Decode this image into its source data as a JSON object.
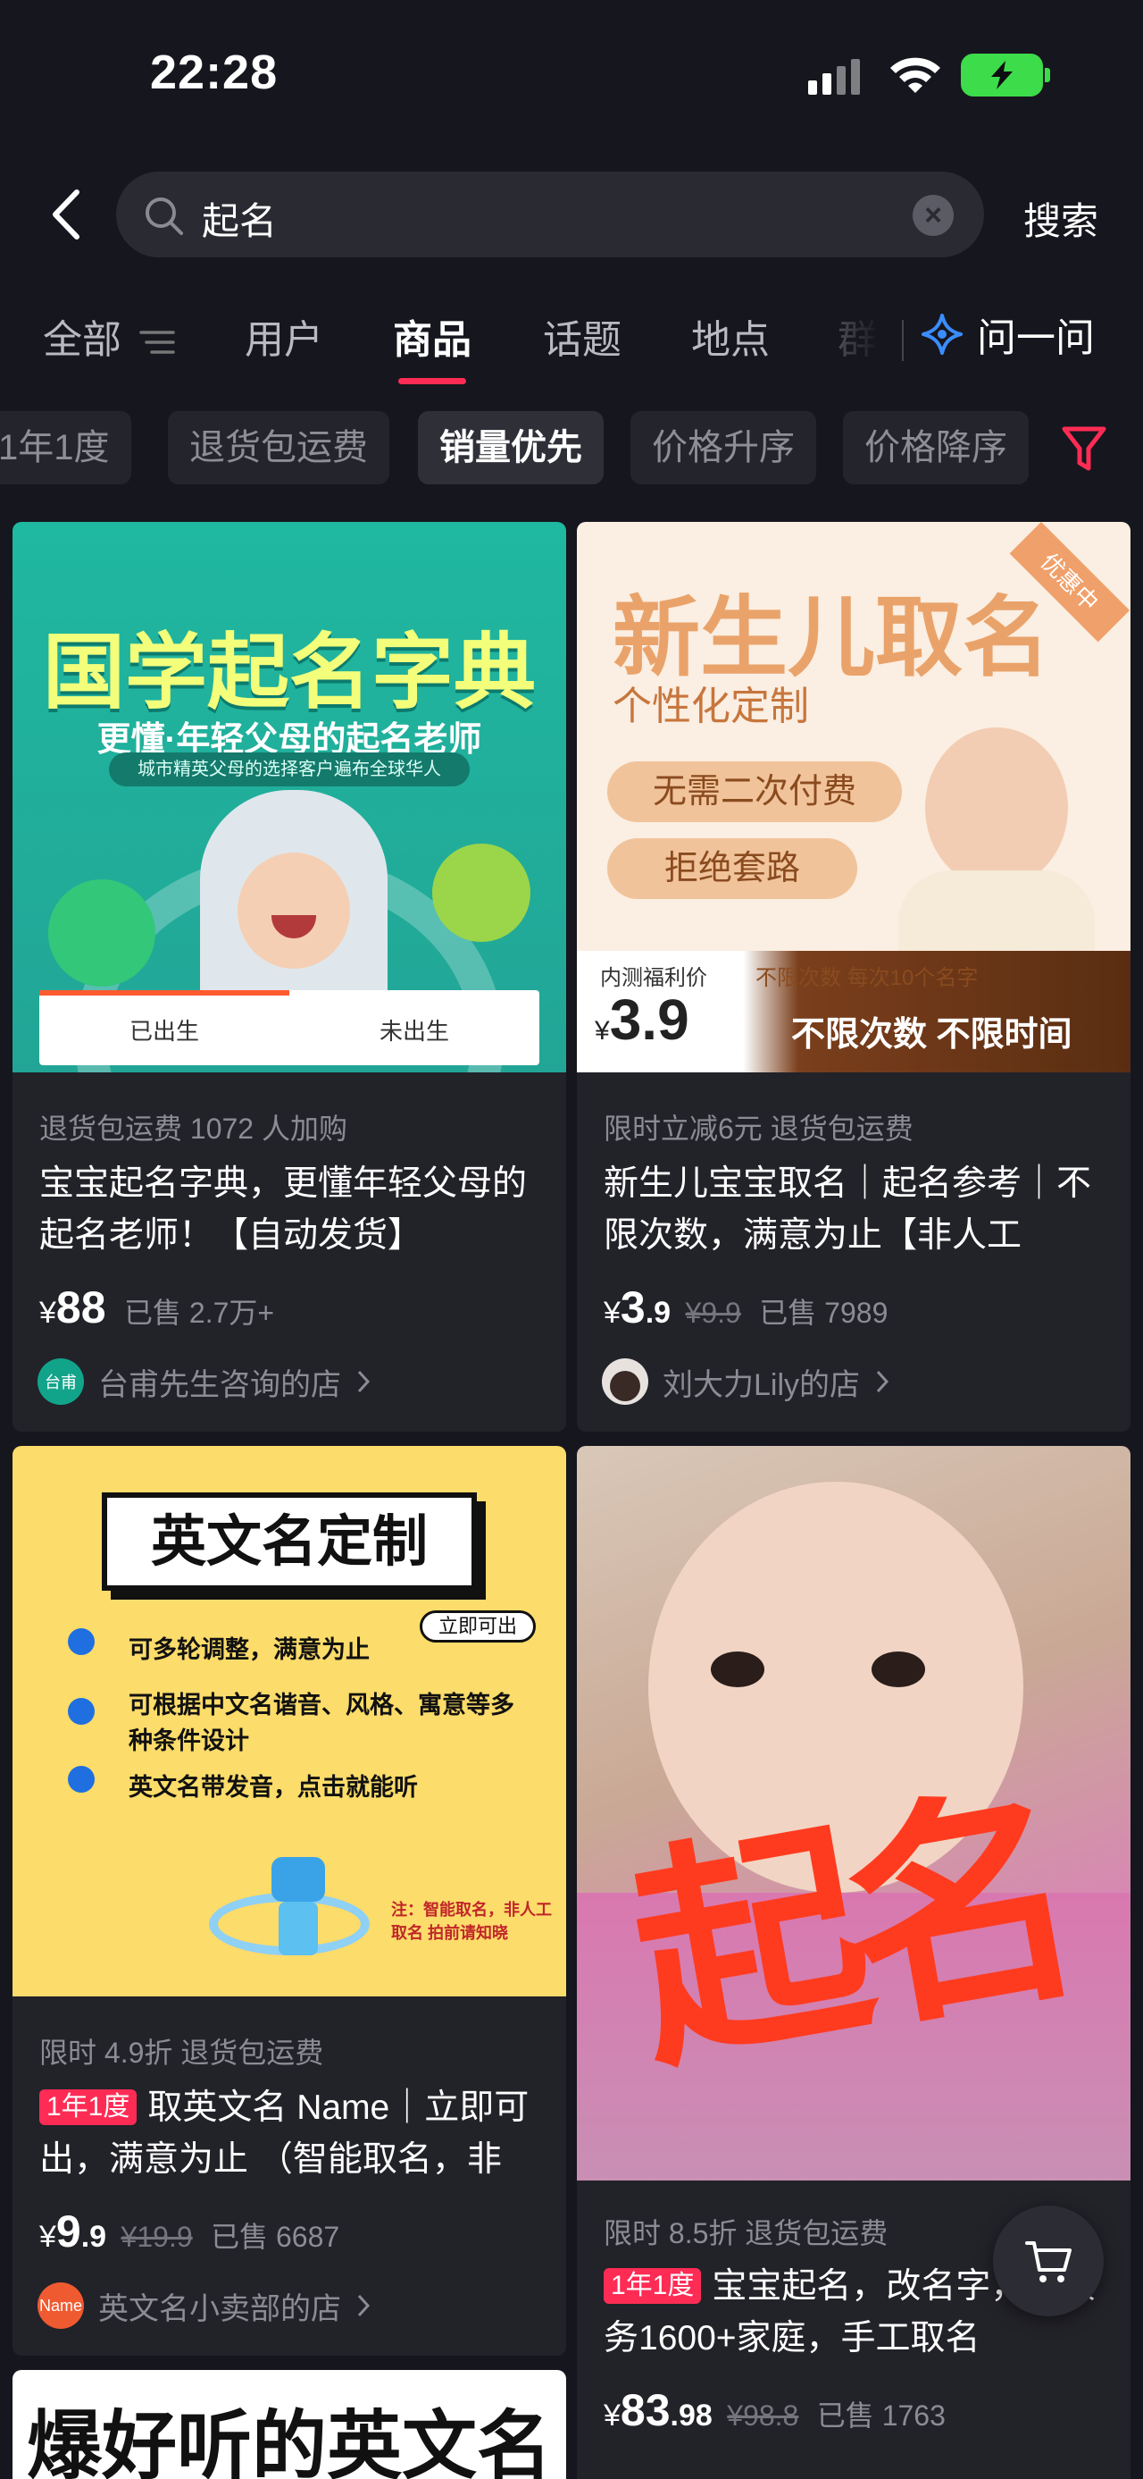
{
  "status": {
    "time": "22:28"
  },
  "search": {
    "query": "起名",
    "button": "搜索"
  },
  "tabs": [
    {
      "label": "全部"
    },
    {
      "label": "用户"
    },
    {
      "label": "商品"
    },
    {
      "label": "话题"
    },
    {
      "label": "地点"
    },
    {
      "label": "群"
    }
  ],
  "ask": {
    "label": "问一问"
  },
  "chips": [
    "1年1度",
    "退货包运费",
    "销量优先",
    "价格升序",
    "价格降序"
  ],
  "cards": [
    {
      "image": {
        "title": "国学起名字典",
        "subtitle": "更懂·年轻父母的起名老师",
        "caption": "城市精英父母的选择客户遍布全球华人",
        "tab_born": "已出生",
        "tab_unborn": "未出生"
      },
      "meta": "退货包运费   1072 人加购",
      "title": "宝宝起名字典，更懂年轻父母的起名老师！【自动发货】",
      "price_cur": "¥",
      "price_int": "88",
      "price_dec": "",
      "price_orig": "",
      "sold": "已售 2.7万+",
      "shop": "台甫先生咨询的店",
      "shop_avatar_text": "台甫"
    },
    {
      "image": {
        "title": "新生儿取名",
        "subtitle": "个性化定制",
        "pill1": "无需二次付费",
        "pill2": "拒绝套路",
        "corner": "优惠中",
        "price_label": "内测福利价",
        "price_cur": "¥",
        "price": "3.9",
        "note": "不限次数 每次10个名字",
        "bottom": "不限次数 不限时间"
      },
      "meta": "限时立减6元   退货包运费",
      "title": "新生儿宝宝取名｜起名参考｜不限次数，满意为止【非人工",
      "price_cur": "¥",
      "price_int": "3",
      "price_dec": ".9",
      "price_orig": "¥9.9",
      "sold": "已售 7989",
      "shop": "刘大力Lily的店"
    },
    {
      "image": {
        "title": "英文名定制",
        "badge": "立即可出",
        "items": [
          "可多轮调整，满意为止",
          "可根据中文名谐音、风格、寓意等多种条件设计",
          "英文名带发音，点击就能听"
        ],
        "note": "注：智能取名，非人工取名 拍前请知晓"
      },
      "meta": "限时 4.9折   退货包运费",
      "tag": "1年1度",
      "title": "取英文名 Name｜立即可出，满意为止 （智能取名，非",
      "price_cur": "¥",
      "price_int": "9",
      "price_dec": ".9",
      "price_orig": "¥19.9",
      "sold": "已售 6687",
      "shop": "英文名小卖部的店",
      "shop_avatar_text": "Name"
    },
    {
      "image": {
        "handwritten": "起名"
      },
      "meta": "限时 8.5折   退货包运费",
      "tag": "1年1度",
      "title": "宝宝起名，改名字，计服务1600+家庭，手工取名",
      "price_cur": "¥",
      "price_int": "83",
      "price_dec": ".98",
      "price_orig": "¥98.8",
      "sold": "已售 1763"
    },
    {
      "image": {
        "title": "爆好听的英文名"
      }
    }
  ],
  "colors": {
    "accent": "#fe2c55",
    "background": "#16161e",
    "card": "#222229"
  }
}
